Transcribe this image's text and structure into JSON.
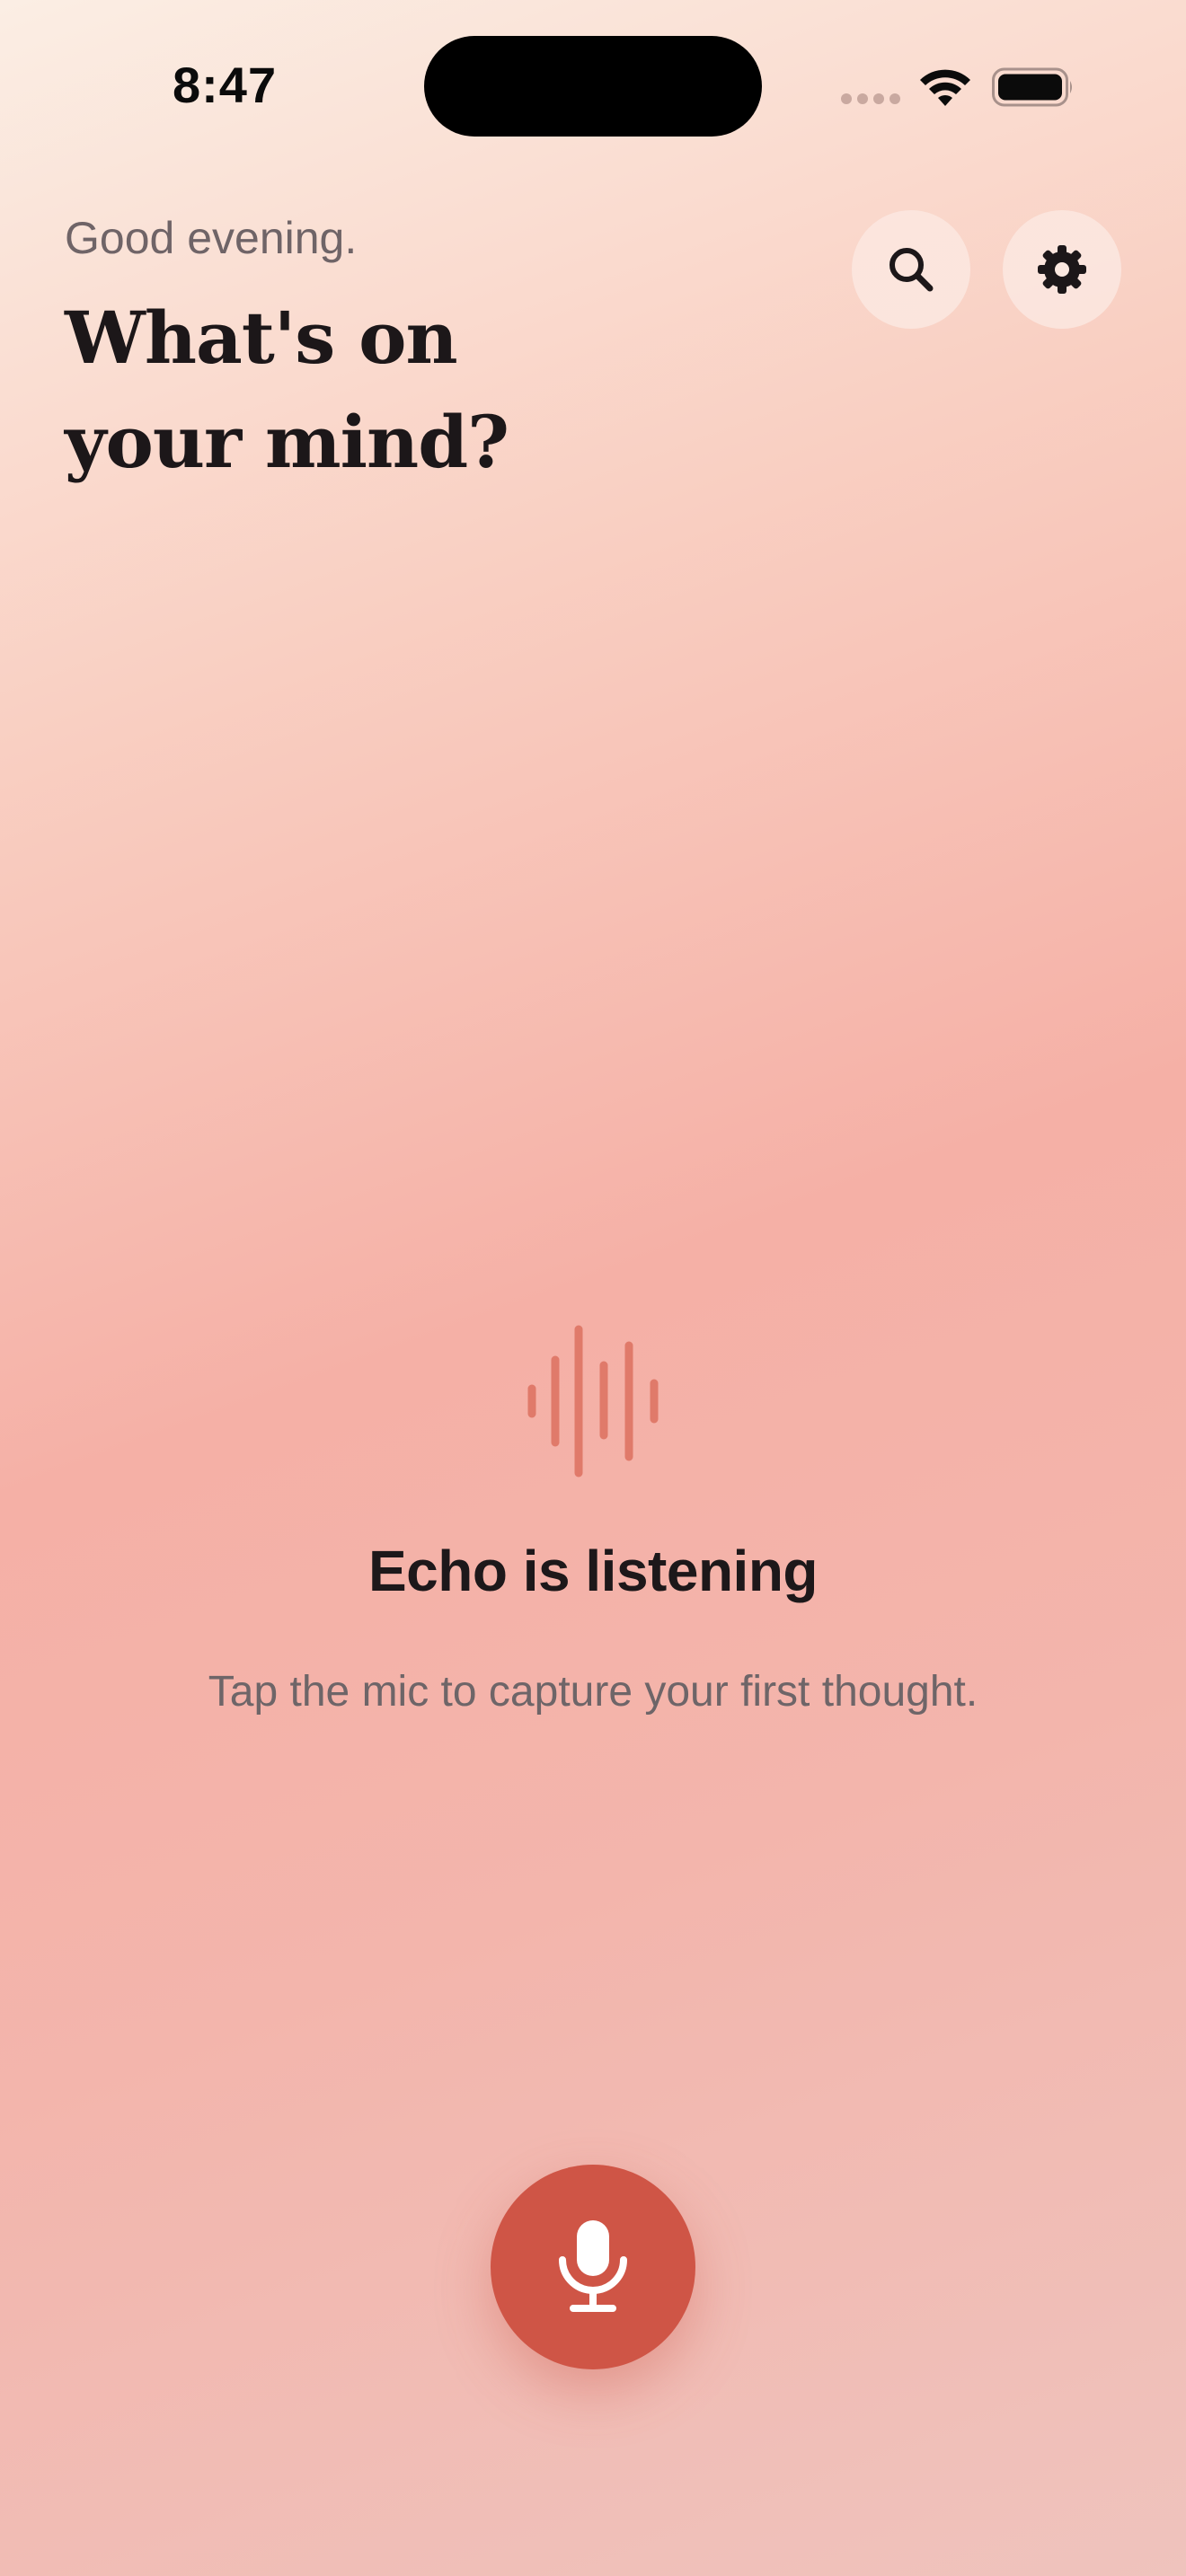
{
  "status_bar": {
    "time": "8:47"
  },
  "header": {
    "greeting": "Good evening.",
    "headline": "What's on your mind?"
  },
  "actions": {
    "search_icon": "search-icon",
    "settings_icon": "gear-icon"
  },
  "empty_state": {
    "icon": "waveform-icon",
    "title": "Echo is listening",
    "subtitle": "Tap the mic to capture your first thought."
  },
  "record": {
    "icon": "microphone-icon"
  },
  "colors": {
    "accent": "#cf5546",
    "wave": "#e07a6a",
    "text_primary": "#1c1719",
    "text_secondary": "#6f6467"
  }
}
